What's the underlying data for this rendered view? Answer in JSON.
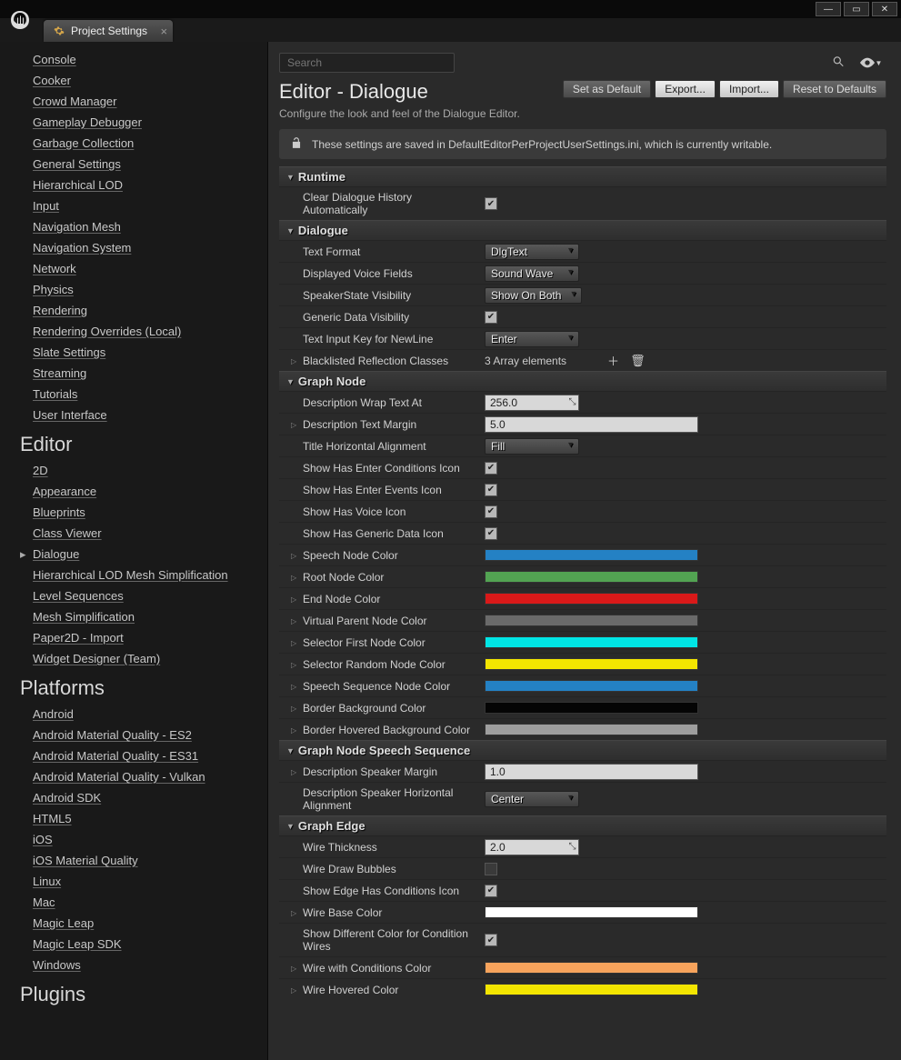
{
  "titlebar": {
    "tab_label": "Project Settings"
  },
  "sidebar": {
    "top_items": [
      "Console",
      "Cooker",
      "Crowd Manager",
      "Gameplay Debugger",
      "Garbage Collection",
      "General Settings",
      "Hierarchical LOD",
      "Input",
      "Navigation Mesh",
      "Navigation System",
      "Network",
      "Physics",
      "Rendering",
      "Rendering Overrides (Local)",
      "Slate Settings",
      "Streaming",
      "Tutorials",
      "User Interface"
    ],
    "groups": [
      {
        "title": "Editor",
        "items": [
          "2D",
          "Appearance",
          "Blueprints",
          "Class Viewer",
          "Dialogue",
          "Hierarchical LOD Mesh Simplification",
          "Level Sequences",
          "Mesh Simplification",
          "Paper2D - Import",
          "Widget Designer (Team)"
        ],
        "active": "Dialogue"
      },
      {
        "title": "Platforms",
        "items": [
          "Android",
          "Android Material Quality - ES2",
          "Android Material Quality - ES31",
          "Android Material Quality - Vulkan",
          "Android SDK",
          "HTML5",
          "iOS",
          "iOS Material Quality",
          "Linux",
          "Mac",
          "Magic Leap",
          "Magic Leap SDK",
          "Windows"
        ]
      },
      {
        "title": "Plugins",
        "items": []
      }
    ]
  },
  "content": {
    "search_placeholder": "Search",
    "title": "Editor - Dialogue",
    "subtitle": "Configure the look and feel of the Dialogue Editor.",
    "buttons": {
      "set_default": "Set as Default",
      "export": "Export...",
      "import": "Import...",
      "reset": "Reset to Defaults"
    },
    "banner": "These settings are saved in DefaultEditorPerProjectUserSettings.ini, which is currently writable.",
    "sections": [
      {
        "title": "Runtime",
        "rows": [
          {
            "label": "Clear Dialogue History Automatically",
            "type": "checkbox",
            "checked": true
          }
        ]
      },
      {
        "title": "Dialogue",
        "rows": [
          {
            "label": "Text Format",
            "type": "dropdown",
            "value": "DlgText"
          },
          {
            "label": "Displayed Voice Fields",
            "type": "dropdown",
            "value": "Sound Wave"
          },
          {
            "label": "SpeakerState Visibility",
            "type": "dropdown",
            "value": "Show On Both"
          },
          {
            "label": "Generic Data Visibility",
            "type": "checkbox",
            "checked": true
          },
          {
            "label": "Text Input Key for NewLine",
            "type": "dropdown",
            "value": "Enter"
          },
          {
            "label": "Blacklisted Reflection Classes",
            "type": "array",
            "value": "3 Array elements",
            "expandable": true
          }
        ]
      },
      {
        "title": "Graph Node",
        "rows": [
          {
            "label": "Description Wrap Text At",
            "type": "numeric",
            "value": "256.0"
          },
          {
            "label": "Description Text Margin",
            "type": "text",
            "value": "5.0",
            "expandable": true
          },
          {
            "label": "Title Horizontal Alignment",
            "type": "dropdown",
            "value": "Fill"
          },
          {
            "label": "Show Has Enter Conditions Icon",
            "type": "checkbox",
            "checked": true
          },
          {
            "label": "Show Has Enter Events Icon",
            "type": "checkbox",
            "checked": true
          },
          {
            "label": "Show Has Voice Icon",
            "type": "checkbox",
            "checked": true
          },
          {
            "label": "Show Has Generic Data Icon",
            "type": "checkbox",
            "checked": true
          },
          {
            "label": "Speech Node Color",
            "type": "color",
            "value": "#2481c4",
            "expandable": true
          },
          {
            "label": "Root Node Color",
            "type": "color",
            "value": "#52a352",
            "expandable": true
          },
          {
            "label": "End Node Color",
            "type": "color",
            "value": "#d91919",
            "expandable": true
          },
          {
            "label": "Virtual Parent Node Color",
            "type": "color",
            "value": "#6a6a6a",
            "expandable": true
          },
          {
            "label": "Selector First Node Color",
            "type": "color",
            "value": "#00e5e5",
            "expandable": true
          },
          {
            "label": "Selector Random Node Color",
            "type": "color",
            "value": "#f3e500",
            "expandable": true
          },
          {
            "label": "Speech Sequence Node Color",
            "type": "color",
            "value": "#2481c4",
            "expandable": true
          },
          {
            "label": "Border Background Color",
            "type": "color",
            "value": "#050505",
            "expandable": true
          },
          {
            "label": "Border Hovered Background Color",
            "type": "color",
            "value": "#9e9e9e",
            "expandable": true
          }
        ]
      },
      {
        "title": "Graph Node Speech Sequence",
        "rows": [
          {
            "label": "Description Speaker Margin",
            "type": "text",
            "value": "1.0",
            "expandable": true
          },
          {
            "label": "Description Speaker Horizontal Alignment",
            "type": "dropdown",
            "value": "Center"
          }
        ]
      },
      {
        "title": "Graph Edge",
        "rows": [
          {
            "label": "Wire Thickness",
            "type": "numeric",
            "value": "2.0"
          },
          {
            "label": "Wire Draw Bubbles",
            "type": "checkbox",
            "checked": false
          },
          {
            "label": "Show Edge Has Conditions Icon",
            "type": "checkbox",
            "checked": true
          },
          {
            "label": "Wire Base Color",
            "type": "color",
            "value": "#ffffff",
            "expandable": true
          },
          {
            "label": "Show Different Color for Condition Wires",
            "type": "checkbox",
            "checked": true
          },
          {
            "label": "Wire with Conditions Color",
            "type": "color",
            "value": "#f7a35c",
            "expandable": true
          },
          {
            "label": "Wire Hovered Color",
            "type": "color",
            "value": "#f3e500",
            "expandable": true
          }
        ]
      }
    ]
  }
}
